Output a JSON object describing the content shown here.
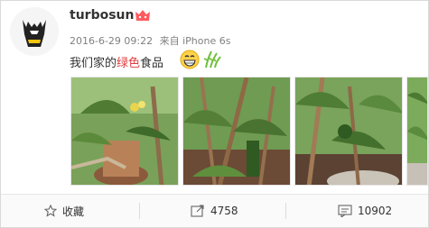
{
  "post": {
    "username": "turbosun",
    "timestamp": "2016-6-29 09:22",
    "source": "来自 iPhone 6s",
    "text_prefix": "我们家的",
    "text_highlight": "绿色",
    "text_suffix": "食品"
  },
  "icons": {
    "badge": "vip-badge-icon",
    "emoji1": "grin-emoji-icon",
    "emoji2": "plant-emoji-icon",
    "favorite": "star-icon",
    "repost": "share-icon",
    "comment": "comment-icon"
  },
  "actions": {
    "favorite_label": "收藏",
    "repost_count": "4758",
    "comment_count": "10902"
  },
  "colors": {
    "accent_red": "#e4393c",
    "muted": "#808080"
  }
}
